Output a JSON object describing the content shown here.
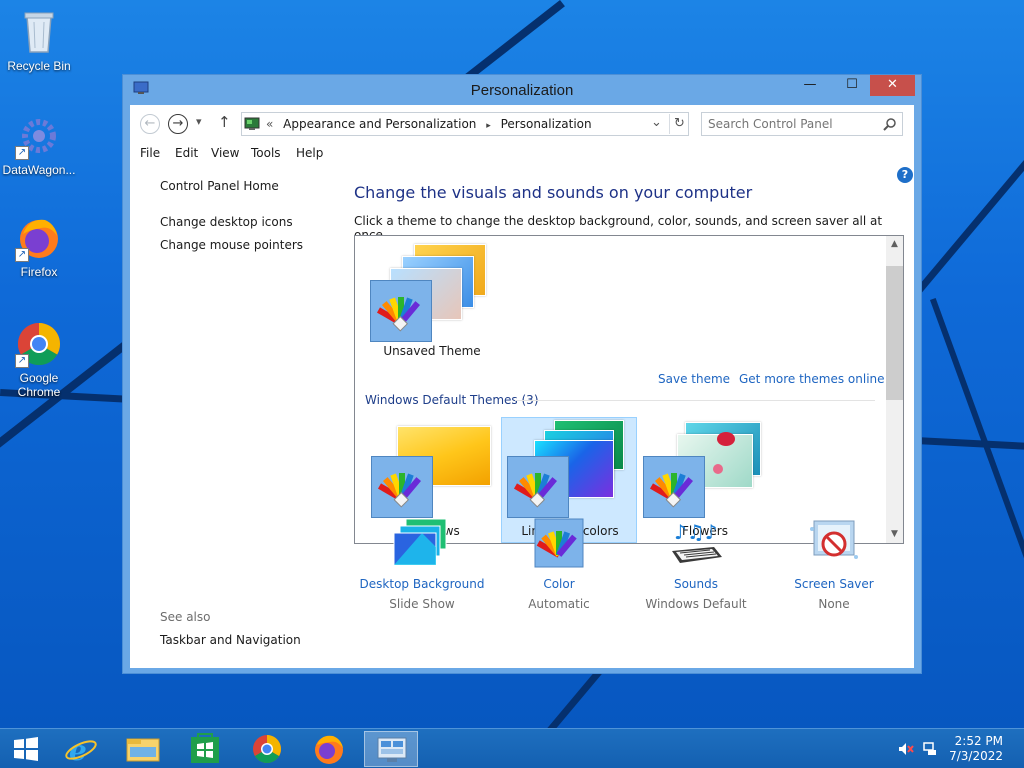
{
  "desktop": {
    "icons": [
      {
        "label": "Recycle Bin",
        "icon": "recycle-bin-icon"
      },
      {
        "label": "DataWagon...",
        "icon": "datawagon-icon"
      },
      {
        "label": "Firefox",
        "icon": "firefox-icon"
      },
      {
        "label": "Google Chrome",
        "icon": "chrome-icon"
      }
    ]
  },
  "window": {
    "title": "Personalization",
    "controls": {
      "minimize": "—",
      "maximize": "☐",
      "close": "✕"
    }
  },
  "nav": {
    "back": "←",
    "forward": "→",
    "recent": "▾",
    "up": "↑",
    "breadcrumb_prefix": "«",
    "breadcrumb": [
      "Appearance and Personalization",
      "Personalization"
    ],
    "separator": "▸",
    "dropdown": "⌄",
    "refresh": "↻",
    "search_placeholder": "Search Control Panel"
  },
  "menubar": [
    "File",
    "Edit",
    "View",
    "Tools",
    "Help"
  ],
  "left_pane": {
    "home": "Control Panel Home",
    "links": [
      "Change desktop icons",
      "Change mouse pointers"
    ],
    "see_also_label": "See also",
    "see_also_links": [
      "Taskbar and Navigation"
    ]
  },
  "main": {
    "heading": "Change the visuals and sounds on your computer",
    "subtext": "Click a theme to change the desktop background, color, sounds, and screen saver all at once.",
    "help": "?",
    "my_themes": [
      {
        "label": "Unsaved Theme"
      }
    ],
    "save_theme": "Save theme",
    "get_more": "Get more themes online",
    "group_label": "Windows Default Themes (3)",
    "default_themes": [
      {
        "label": "Windows",
        "selected": false
      },
      {
        "label": "Lines and colors",
        "selected": true
      },
      {
        "label": "Flowers",
        "selected": false
      }
    ],
    "settings": [
      {
        "label": "Desktop Background",
        "value": "Slide Show",
        "icon": "desktop-background-icon"
      },
      {
        "label": "Color",
        "value": "Automatic",
        "icon": "color-icon"
      },
      {
        "label": "Sounds",
        "value": "Windows Default",
        "icon": "sounds-icon"
      },
      {
        "label": "Screen Saver",
        "value": "None",
        "icon": "screen-saver-icon"
      }
    ]
  },
  "taskbar": {
    "apps": [
      "start-icon",
      "internet-explorer-icon",
      "file-explorer-icon",
      "store-icon",
      "chrome-icon",
      "firefox-icon",
      "control-panel-icon"
    ],
    "active_app": "control-panel-icon",
    "time": "2:52 PM",
    "date": "7/3/2022"
  },
  "colors": {
    "accent": "#1e65c1",
    "heading": "#1e3287",
    "close_button": "#c7504b",
    "selection": "#cde8ff"
  }
}
